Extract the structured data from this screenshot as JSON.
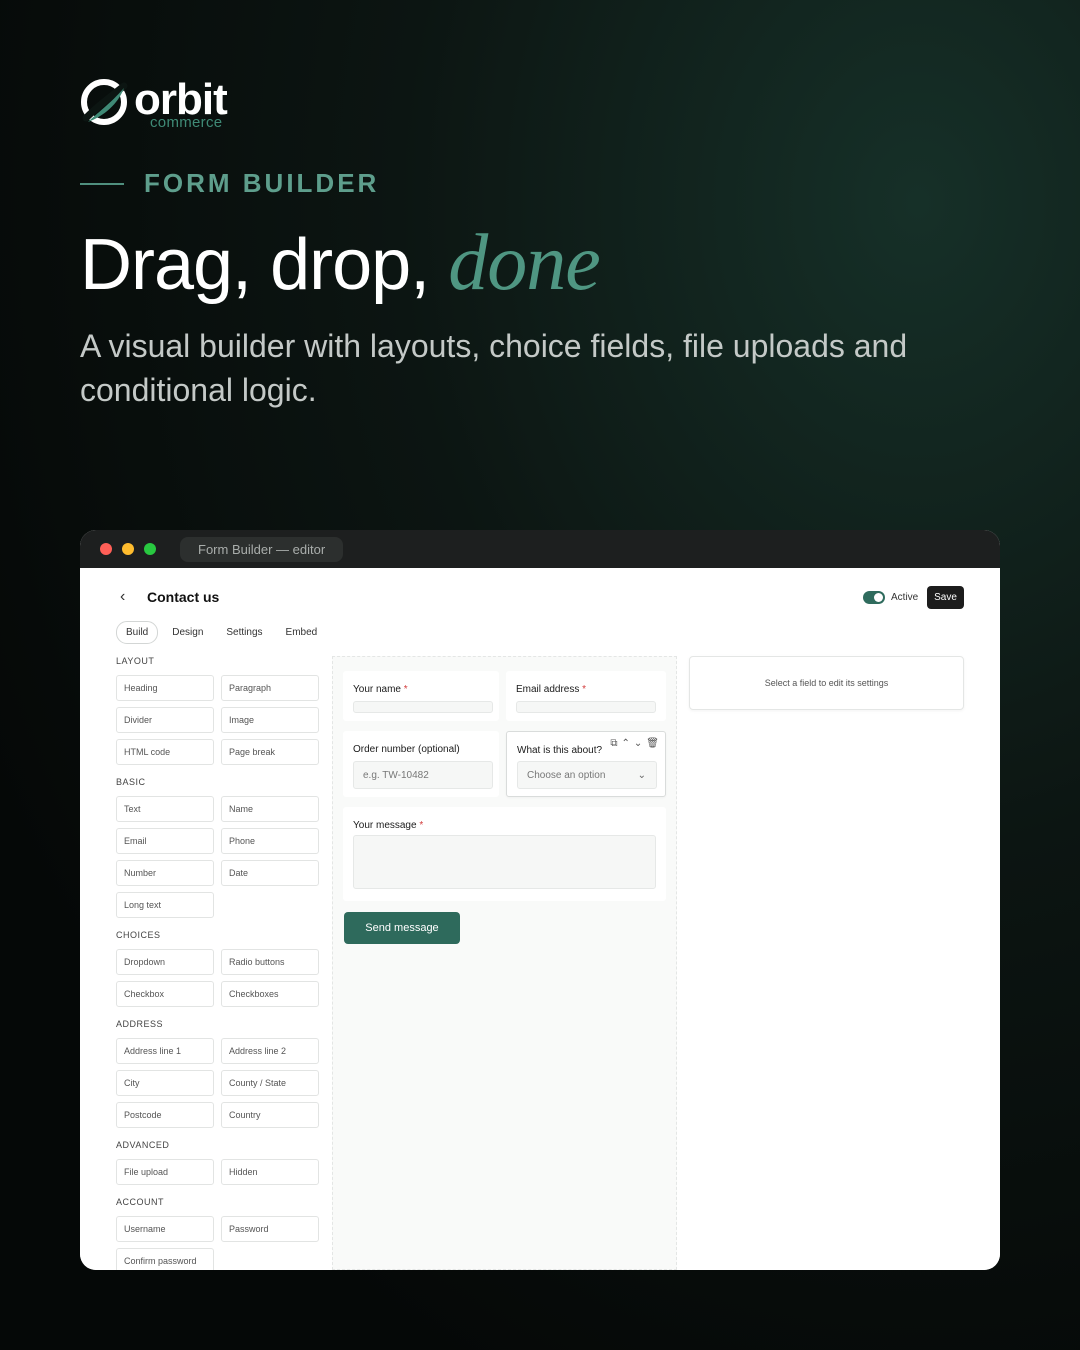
{
  "brand": {
    "name": "orbit",
    "tagline": "commerce",
    "accent_color": "#4f9682"
  },
  "eyebrow": "FORM BUILDER",
  "headline": {
    "plain": "Drag, drop,",
    "accent": "done"
  },
  "subheading": "A visual builder with layouts, choice fields, file uploads and conditional logic.",
  "window": {
    "tab_title": "Form Builder — editor"
  },
  "editor": {
    "back_icon": "chevron-left-icon",
    "back_glyph": "‹",
    "title": "Contact us",
    "active_label": "Active",
    "active_on": true,
    "save_label": "Save",
    "tabs": [
      {
        "label": "Build",
        "selected": true
      },
      {
        "label": "Design",
        "selected": false
      },
      {
        "label": "Settings",
        "selected": false
      },
      {
        "label": "Embed",
        "selected": false
      }
    ],
    "palette": [
      {
        "title": "LAYOUT",
        "items": [
          "Heading",
          "Paragraph",
          "Divider",
          "Image",
          "HTML code",
          "Page break"
        ]
      },
      {
        "title": "BASIC",
        "items": [
          "Text",
          "Name",
          "Email",
          "Phone",
          "Number",
          "Date",
          "Long text"
        ]
      },
      {
        "title": "CHOICES",
        "items": [
          "Dropdown",
          "Radio buttons",
          "Checkbox",
          "Checkboxes"
        ]
      },
      {
        "title": "ADDRESS",
        "items": [
          "Address line 1",
          "Address line 2",
          "City",
          "County / State",
          "Postcode",
          "Country"
        ]
      },
      {
        "title": "ADVANCED",
        "items": [
          "File upload",
          "Hidden"
        ]
      },
      {
        "title": "ACCOUNT",
        "items": [
          "Username",
          "Password",
          "Confirm password"
        ]
      }
    ],
    "form": {
      "your_name": {
        "label": "Your name",
        "required_mark": "*"
      },
      "email": {
        "label": "Email address",
        "required_mark": "*"
      },
      "order_number": {
        "label": "Order number (optional)",
        "placeholder": "e.g. TW-10482"
      },
      "topic": {
        "label": "What is this about?",
        "placeholder": "Choose an option",
        "tool_icons": [
          "copy-icon",
          "arrow-up-icon",
          "arrow-down-icon",
          "trash-icon"
        ]
      },
      "message": {
        "label": "Your message",
        "required_mark": "*"
      },
      "submit_label": "Send message"
    },
    "settings_hint": "Select a field to edit its settings"
  }
}
